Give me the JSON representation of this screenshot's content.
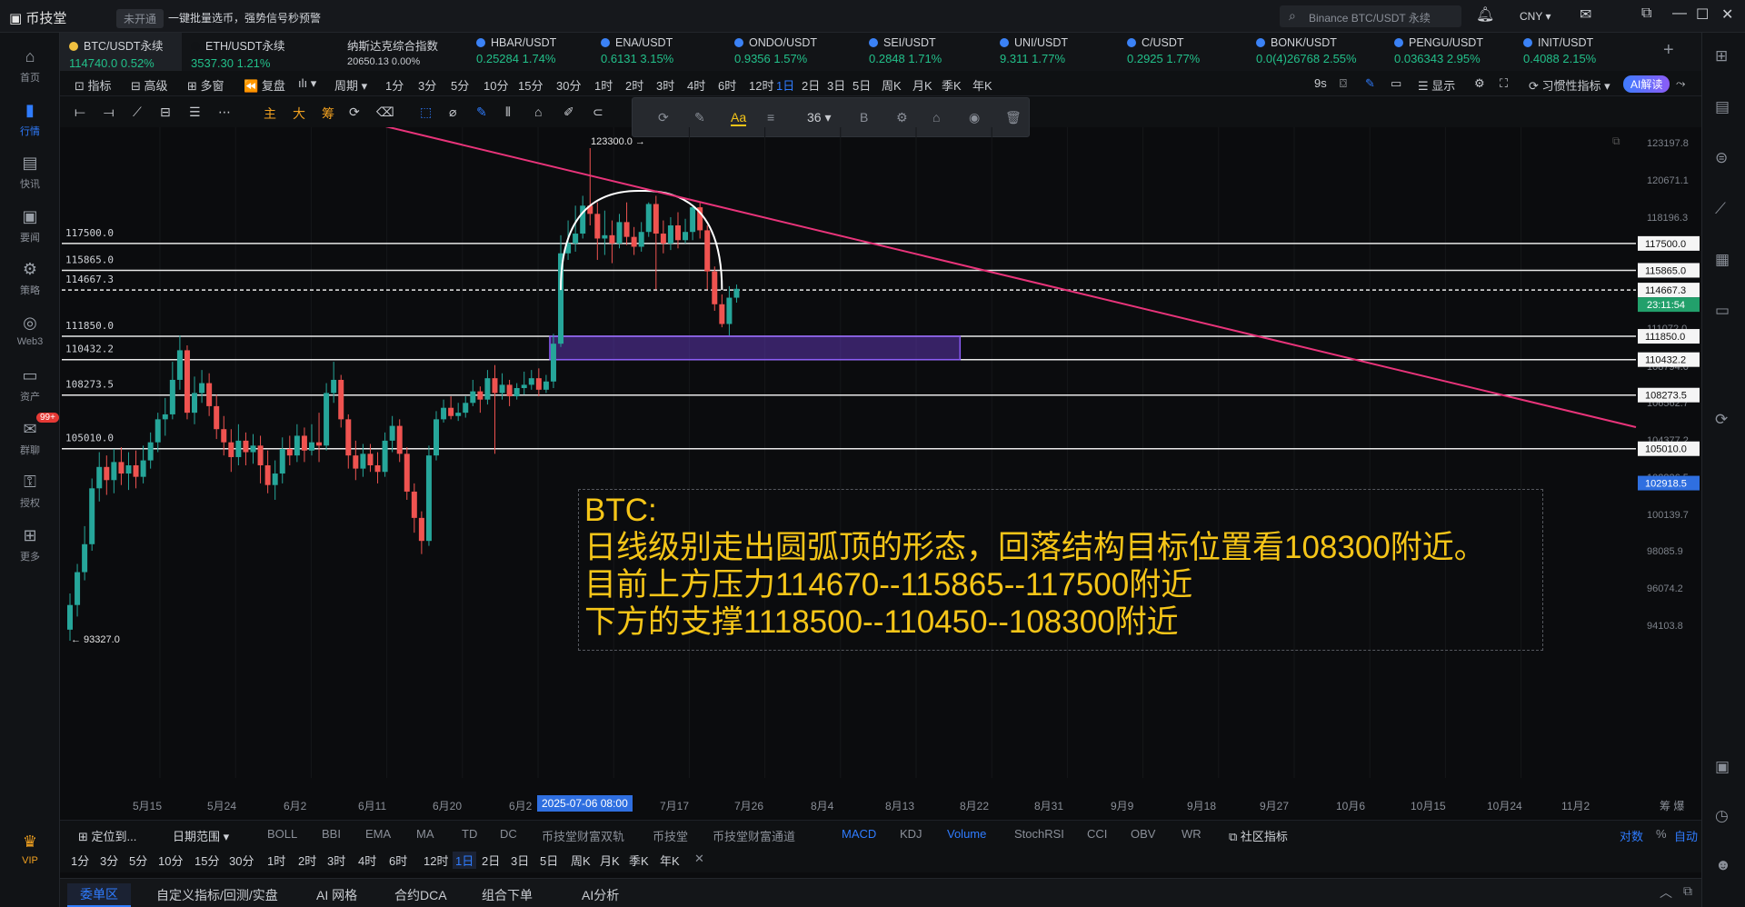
{
  "app": {
    "title": "币技堂",
    "badge": "未开通",
    "slogan": "一键批量选币，强势信号秒预警",
    "search_placeholder": "Binance BTC/USDT 永续",
    "currency": "CNY"
  },
  "nav": [
    {
      "label": "首页",
      "icon": "home-icon"
    },
    {
      "label": "行情",
      "icon": "market-icon",
      "active": true
    },
    {
      "label": "快讯",
      "icon": "news-icon"
    },
    {
      "label": "要闻",
      "icon": "headline-icon"
    },
    {
      "label": "策略",
      "icon": "strategy-icon"
    },
    {
      "label": "Web3",
      "icon": "web3-icon"
    },
    {
      "label": "资产",
      "icon": "wallet-icon"
    },
    {
      "label": "群聊",
      "icon": "chat-icon",
      "badge": "99+"
    },
    {
      "label": "授权",
      "icon": "auth-icon"
    },
    {
      "label": "更多",
      "icon": "more-icon"
    },
    {
      "label": "VIP",
      "icon": "vip-icon"
    }
  ],
  "tickers": [
    {
      "name": "BTC/USDT永续",
      "value": "114740.0  0.52%",
      "selected": true
    },
    {
      "name": "ETH/USDT永续",
      "value": "3537.30  1.21%"
    },
    {
      "name": "纳斯达克综合指数",
      "value": "20650.13  0.00%"
    },
    {
      "name": "HBAR/USDT",
      "value": "0.25284  1.74%"
    },
    {
      "name": "ENA/USDT",
      "value": "0.6131  3.15%"
    },
    {
      "name": "ONDO/USDT",
      "value": "0.9356  1.57%"
    },
    {
      "name": "SEI/USDT",
      "value": "0.2848  1.71%"
    },
    {
      "name": "UNI/USDT",
      "value": "9.311  1.77%"
    },
    {
      "name": "C/USDT",
      "value": "0.2925  1.77%"
    },
    {
      "name": "BONK/USDT",
      "value": "0.0(4)26768  2.55%"
    },
    {
      "name": "PENGU/USDT",
      "value": "0.036343  2.95%"
    },
    {
      "name": "INIT/USDT",
      "value": "0.4088  2.15%"
    }
  ],
  "toolbar": {
    "indicator": "指标",
    "advanced": "高级",
    "multi": "多窗",
    "replay": "复盘",
    "cycle": "周期",
    "periods": [
      "1分",
      "3分",
      "5分",
      "10分",
      "15分",
      "30分",
      "1时",
      "2时",
      "3时",
      "4时",
      "6时",
      "12时",
      "1日",
      "2日",
      "3日",
      "5日",
      "周K",
      "月K",
      "季K",
      "年K"
    ],
    "active_period": "1日",
    "countdown": "9s",
    "display": "显示",
    "habit": "习惯性指标",
    "ai": "AI解读"
  },
  "drawbar": {
    "main": "主",
    "big": "大",
    "chip": "筹"
  },
  "floattool": {
    "font": "Aa",
    "size": "36",
    "bold": "B"
  },
  "chart_data": {
    "type": "candlestick",
    "price_axis_ticks": [
      "123197.8",
      "120671.1",
      "118196.3",
      "115865.0",
      "114667.3",
      "111850.0",
      "111072.0",
      "110432.2",
      "108794.0",
      "108273.5",
      "106562.7",
      "105010.0",
      "104377.2",
      "102918.5",
      "102236.5",
      "100139.7",
      "98085.9",
      "96074.2",
      "94103.8"
    ],
    "ylim": [
      93327.0,
      123300.0
    ],
    "horizontal_levels": [
      {
        "label": "117500.0",
        "value": 117500.0
      },
      {
        "label": "115865.0",
        "value": 115865.0
      },
      {
        "label": "114667.3",
        "value": 114667.3,
        "dashed": true
      },
      {
        "label": "111850.0",
        "value": 111850.0
      },
      {
        "label": "110432.2",
        "value": 110432.2
      },
      {
        "label": "108273.5",
        "value": 108273.5
      },
      {
        "label": "105010.0",
        "value": 105010.0
      }
    ],
    "high_marker": "123300.0",
    "low_marker": "93327.0",
    "current_price": "114667.3",
    "countdown": "23:11:54",
    "right_marker": "102918.5",
    "time_ticks": [
      "5月15",
      "5月24",
      "6月2",
      "6月11",
      "6月20",
      "6月2",
      "7月17",
      "7月26",
      "8月4",
      "8月13",
      "8月22",
      "8月31",
      "9月9",
      "9月18",
      "9月27",
      "10月6",
      "10月15",
      "10月24",
      "11月2"
    ],
    "crosshair_date": "2025-07-06 08:00",
    "candles": [
      [
        94000,
        95500,
        93327,
        96200
      ],
      [
        95500,
        97500,
        94800,
        98000
      ],
      [
        97500,
        99200,
        97000,
        100300
      ],
      [
        99200,
        102600,
        98800,
        103200
      ],
      [
        102600,
        103900,
        101800,
        104800
      ],
      [
        103900,
        103100,
        102200,
        104600
      ],
      [
        103100,
        104200,
        102300,
        105000
      ],
      [
        104200,
        103500,
        102800,
        105100
      ],
      [
        103500,
        104000,
        102500,
        104800
      ],
      [
        104000,
        103300,
        102600,
        104900
      ],
      [
        103300,
        104300,
        102900,
        105200
      ],
      [
        104300,
        105400,
        103800,
        106000
      ],
      [
        105400,
        106800,
        104800,
        107200
      ],
      [
        106800,
        107100,
        105800,
        108100
      ],
      [
        107100,
        109200,
        106800,
        110300
      ],
      [
        109200,
        111000,
        108600,
        111900
      ],
      [
        111000,
        107200,
        106800,
        111300
      ],
      [
        107200,
        108400,
        106500,
        109400
      ],
      [
        108400,
        109000,
        107800,
        109800
      ],
      [
        109000,
        107600,
        107000,
        109600
      ],
      [
        107600,
        106200,
        105600,
        108300
      ],
      [
        106200,
        105400,
        104600,
        107000
      ],
      [
        105400,
        104500,
        103600,
        106200
      ],
      [
        104500,
        105500,
        104000,
        106500
      ],
      [
        105500,
        104800,
        104000,
        106000
      ],
      [
        104800,
        105200,
        104100,
        105900
      ],
      [
        105200,
        104000,
        102900,
        105800
      ],
      [
        104000,
        102800,
        102300,
        104900
      ],
      [
        102800,
        103500,
        101900,
        104300
      ],
      [
        103500,
        105000,
        102900,
        105700
      ],
      [
        105000,
        104600,
        104000,
        105800
      ],
      [
        104600,
        105800,
        104200,
        106500
      ],
      [
        105800,
        104900,
        104200,
        106300
      ],
      [
        104900,
        105400,
        104600,
        106500
      ],
      [
        105400,
        105200,
        104200,
        107200
      ],
      [
        105200,
        108400,
        104900,
        109000
      ],
      [
        108400,
        109200,
        107800,
        110300
      ],
      [
        109200,
        106800,
        106300,
        109500
      ],
      [
        106800,
        104600,
        103800,
        107100
      ],
      [
        104600,
        103800,
        103100,
        105500
      ],
      [
        103800,
        104700,
        103300,
        105300
      ],
      [
        104700,
        104000,
        103600,
        105300
      ],
      [
        104000,
        103600,
        102900,
        104800
      ],
      [
        103600,
        105500,
        103300,
        106000
      ],
      [
        105500,
        106400,
        104800,
        107000
      ],
      [
        106400,
        104700,
        104200,
        106800
      ],
      [
        104700,
        102400,
        101900,
        105100
      ],
      [
        102400,
        100800,
        99900,
        102900
      ],
      [
        100800,
        99400,
        98600,
        101200
      ],
      [
        99400,
        104600,
        99100,
        105200
      ],
      [
        104600,
        106800,
        104300,
        107300
      ],
      [
        106800,
        107500,
        106600,
        108000
      ],
      [
        107500,
        107000,
        106800,
        108200
      ],
      [
        107000,
        107200,
        106700,
        107800
      ],
      [
        107200,
        107800,
        106900,
        108200
      ],
      [
        107800,
        108500,
        107600,
        109200
      ],
      [
        108500,
        108000,
        107200,
        108800
      ],
      [
        108000,
        109300,
        107700,
        109800
      ],
      [
        109300,
        108400,
        104700,
        110100
      ],
      [
        108400,
        108900,
        108000,
        109600
      ],
      [
        108900,
        108200,
        107600,
        109200
      ],
      [
        108200,
        108700,
        108000,
        109000
      ],
      [
        108700,
        108900,
        108300,
        109700
      ],
      [
        108900,
        109300,
        108600,
        109800
      ],
      [
        109300,
        108600,
        108200,
        109900
      ],
      [
        108600,
        109100,
        108400,
        109500
      ],
      [
        109100,
        111400,
        108700,
        112000
      ],
      [
        111400,
        116900,
        111200,
        118000
      ],
      [
        116900,
        117500,
        116500,
        118900
      ],
      [
        117500,
        118100,
        117000,
        119800
      ],
      [
        118100,
        119800,
        117800,
        120400
      ],
      [
        119800,
        119300,
        118600,
        123300
      ],
      [
        119300,
        117800,
        116500,
        120000
      ],
      [
        117800,
        118000,
        116800,
        119500
      ],
      [
        118000,
        117500,
        116300,
        118900
      ],
      [
        117500,
        118800,
        117200,
        119300
      ],
      [
        118800,
        117900,
        117400,
        120000
      ],
      [
        117900,
        117300,
        116800,
        118500
      ],
      [
        117300,
        118200,
        117000,
        118800
      ],
      [
        118200,
        119900,
        117900,
        120000
      ],
      [
        119900,
        118100,
        114700,
        120400
      ],
      [
        118100,
        117500,
        116900,
        118900
      ],
      [
        117500,
        118600,
        117100,
        119100
      ],
      [
        118600,
        117700,
        117200,
        119400
      ],
      [
        117700,
        118200,
        117500,
        119000
      ],
      [
        118200,
        119700,
        117700,
        119800
      ],
      [
        119700,
        118300,
        117800,
        120000
      ],
      [
        118300,
        115800,
        114700,
        118600
      ],
      [
        115800,
        113800,
        113400,
        116100
      ],
      [
        113800,
        112600,
        112400,
        114400
      ],
      [
        112600,
        114200,
        111900,
        114900
      ],
      [
        114200,
        114740,
        113900,
        115000
      ]
    ],
    "zone": {
      "from_index": 66,
      "to_index": 122,
      "low": 110432.2,
      "high": 111850.0
    },
    "trendline": {
      "from_index": 36,
      "from_price": 125200,
      "to_index": 200,
      "to_price": 108600
    },
    "arc": {
      "from_index": 67,
      "to_index": 89,
      "base_price": 114667.3,
      "top_price": 120700
    }
  },
  "annotation": {
    "line1": "BTC:",
    "line2": "日线级别走出圆弧顶的形态，回落结构目标位置看108300附近。",
    "line3": "目前上方压力114670--115865--117500附近",
    "line4": "下方的支撑1118500--110450--108300附近"
  },
  "indicators": {
    "locate": "定位到...",
    "range": "日期范围",
    "list": [
      "BOLL",
      "BBI",
      "EMA",
      "MA",
      "TD",
      "DC",
      "币技堂财富双轨",
      "币技堂",
      "币技堂财富通道"
    ],
    "sub": [
      "MACD",
      "KDJ",
      "Volume",
      "StochRSI",
      "CCI",
      "OBV",
      "WR"
    ],
    "community": "社区指标",
    "log": "对数",
    "percent": "%",
    "auto": "自动"
  },
  "bottom_tabs": [
    "委单区",
    "自定义指标/回测/实盘",
    "AI 网格",
    "合约DCA",
    "组合下单",
    "AI分析"
  ],
  "colors": {
    "up": "#26a69a",
    "down": "#ef5350",
    "trend": "#e8347a",
    "zone": "#6c3fd0",
    "accent": "#2f7cff",
    "annotation": "#f5c518"
  }
}
